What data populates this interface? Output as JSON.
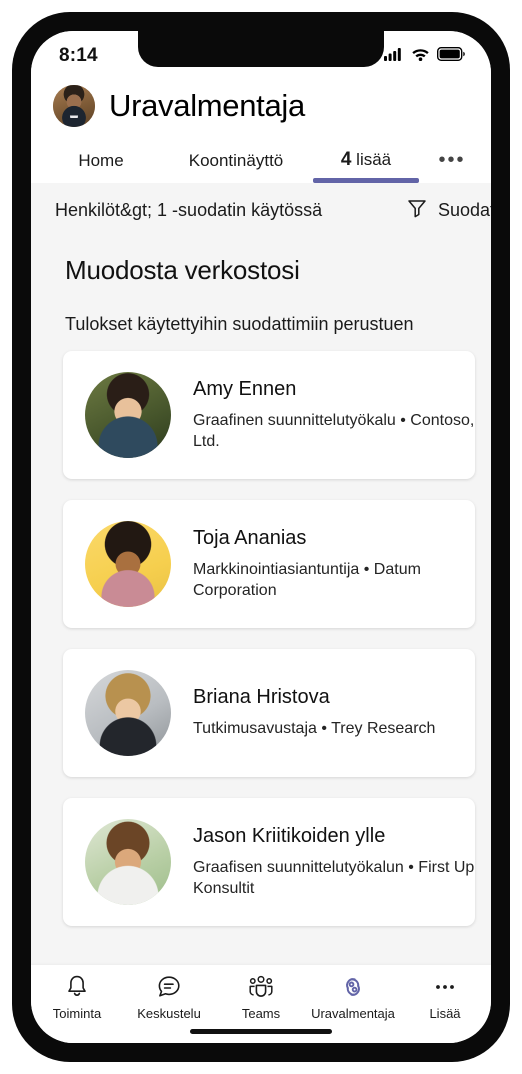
{
  "status_bar": {
    "time": "8:14",
    "icons": [
      "signal-icon",
      "wifi-icon",
      "battery-icon"
    ]
  },
  "header": {
    "title": "Uravalmentaja",
    "avatar": "user-avatar"
  },
  "tabs": [
    {
      "label": "Home",
      "active": false
    },
    {
      "label": "Koontinäyttö",
      "active": false
    },
    {
      "count": "4",
      "label": "lisää",
      "active": true
    },
    {
      "label": "…",
      "active": false
    }
  ],
  "filter": {
    "summary": "Henkilöt&gt; 1 -suodatin käytössä",
    "button_label": "Suodata",
    "button_icon": "filter-funnel-icon"
  },
  "main": {
    "section_title": "Muodosta verkostosi",
    "section_subtitle": "Tulokset käytettyihin suodattimiin perustuen",
    "people": [
      {
        "name": "Amy Ennen",
        "role": "Graafinen suunnittelutyökalu • Contoso, Ltd."
      },
      {
        "name": "Toja Ananias",
        "role": "Markkinointiasiantuntija • Datum Corporation"
      },
      {
        "name": "Briana Hristova",
        "role": "Tutkimusavustaja • Trey Research"
      },
      {
        "name": "Jason  Kriitikoiden ylle",
        "role": "Graafisen suunnittelutyökalun • First Up Konsultit"
      }
    ]
  },
  "bottom_nav": [
    {
      "label": "Toiminta",
      "icon": "bell-icon",
      "active": false
    },
    {
      "label": "Keskustelu",
      "icon": "chat-icon",
      "active": false
    },
    {
      "label": "Teams",
      "icon": "people-group-icon",
      "active": false
    },
    {
      "label": "Uravalmentaja",
      "icon": "career-coach-icon",
      "active": true
    },
    {
      "label": "Lisää",
      "icon": "ellipsis-icon",
      "active": false
    }
  ],
  "colors": {
    "accent": "#6264A7",
    "page_background": "#F5F5F5",
    "card_background": "#FFFFFF",
    "text": "#1B1B1B"
  }
}
